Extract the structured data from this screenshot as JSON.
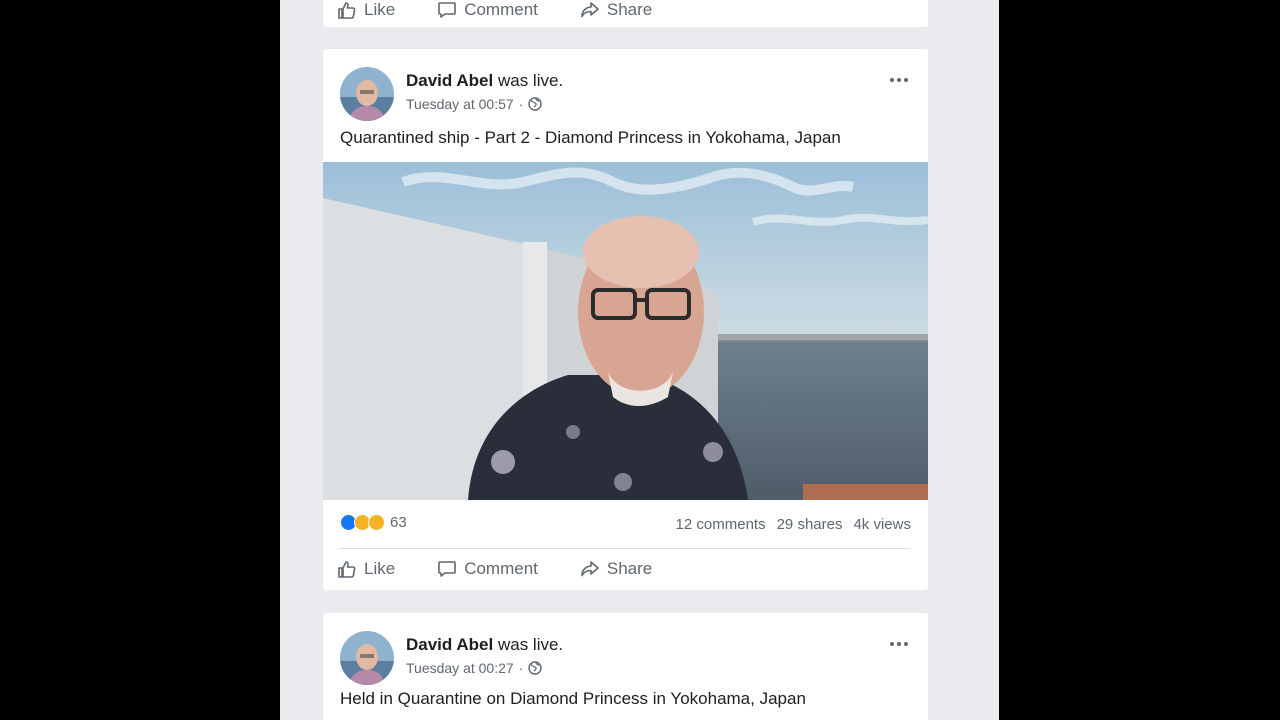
{
  "actions": {
    "like": "Like",
    "comment": "Comment",
    "share": "Share"
  },
  "posts": [
    {
      "author": "David Abel",
      "status": "was live.",
      "time": "Tuesday at 00:57",
      "separator": "·",
      "text": "Quarantined ship - Part 2 - Diamond Princess in Yokohama, Japan",
      "reaction_count": "63",
      "comments": "12 comments",
      "shares": "29 shares",
      "views": "4k views"
    },
    {
      "author": "David Abel",
      "status": "was live.",
      "time": "Tuesday at 00:27",
      "separator": "·",
      "text": "Held in Quarantine on Diamond Princess in Yokohama, Japan"
    }
  ],
  "icons": {
    "more": "more-options-icon",
    "audience": "globe-icon",
    "like": "thumbs-up-icon",
    "comment": "speech-bubble-icon",
    "share": "share-arrow-icon"
  },
  "colors": {
    "feed_bg": "#e9ebee",
    "card_bg": "#ffffff",
    "meta_text": "#606770",
    "like_blue": "#1877f2",
    "reaction_yellow": "#f7b125"
  }
}
